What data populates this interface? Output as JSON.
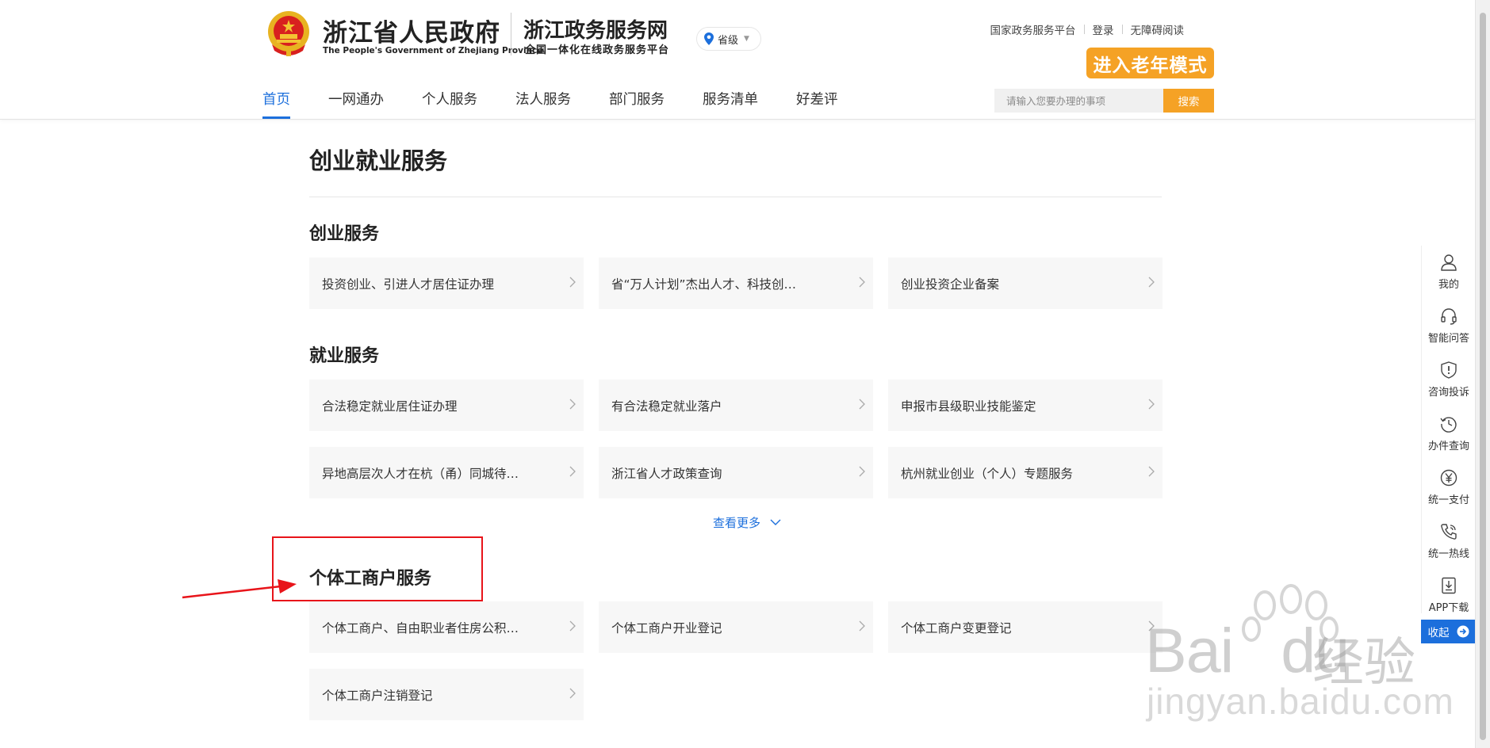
{
  "header": {
    "gov_name": "浙江省人民政府",
    "gov_name_en": "The People's Government of Zhejiang Province",
    "site_name": "浙江政务服务网",
    "site_subtitle": "全国一体化在线政务服务平台",
    "region": "省级",
    "top_links": [
      "国家政务服务平台",
      "登录",
      "无障碍阅读"
    ],
    "elder_mode": "进入老年模式",
    "nav": [
      "首页",
      "一网通办",
      "个人服务",
      "法人服务",
      "部门服务",
      "服务清单",
      "好差评"
    ],
    "search_placeholder": "请输入您要办理的事项",
    "search_button": "搜索"
  },
  "main": {
    "title": "创业就业服务",
    "sections": [
      {
        "title": "创业服务",
        "items": [
          "投资创业、引进人才居住证办理",
          "省“万人计划”杰出人才、科技创…",
          "创业投资企业备案"
        ]
      },
      {
        "title": "就业服务",
        "items": [
          "合法稳定就业居住证办理",
          "有合法稳定就业落户",
          "申报市县级职业技能鉴定",
          "异地高层次人才在杭（甬）同城待…",
          "浙江省人才政策查询",
          "杭州就业创业（个人）专题服务"
        ]
      },
      {
        "title": "个体工商户服务",
        "items": [
          "个体工商户、自由职业者住房公积…",
          "个体工商户开业登记",
          "个体工商户变更登记",
          "个体工商户注销登记"
        ]
      }
    ],
    "more_link": "查看更多"
  },
  "sidebar": {
    "items": [
      {
        "label": "我的",
        "icon": "user-icon"
      },
      {
        "label": "智能问答",
        "icon": "headset-icon"
      },
      {
        "label": "咨询投诉",
        "icon": "shield-alert-icon"
      },
      {
        "label": "办件查询",
        "icon": "history-icon"
      },
      {
        "label": "统一支付",
        "icon": "yuan-icon"
      },
      {
        "label": "统一热线",
        "icon": "phone-icon"
      },
      {
        "label": "APP下载",
        "icon": "download-icon"
      }
    ],
    "collapse": "收起"
  },
  "watermark": {
    "brand_left": "Bai",
    "brand_right": "du",
    "brand_cn": "经验",
    "url": "jingyan.baidu.com"
  },
  "colors": {
    "accent": "#1c6fdc",
    "orange": "#f5a225",
    "annotation_red": "#e8141a"
  }
}
